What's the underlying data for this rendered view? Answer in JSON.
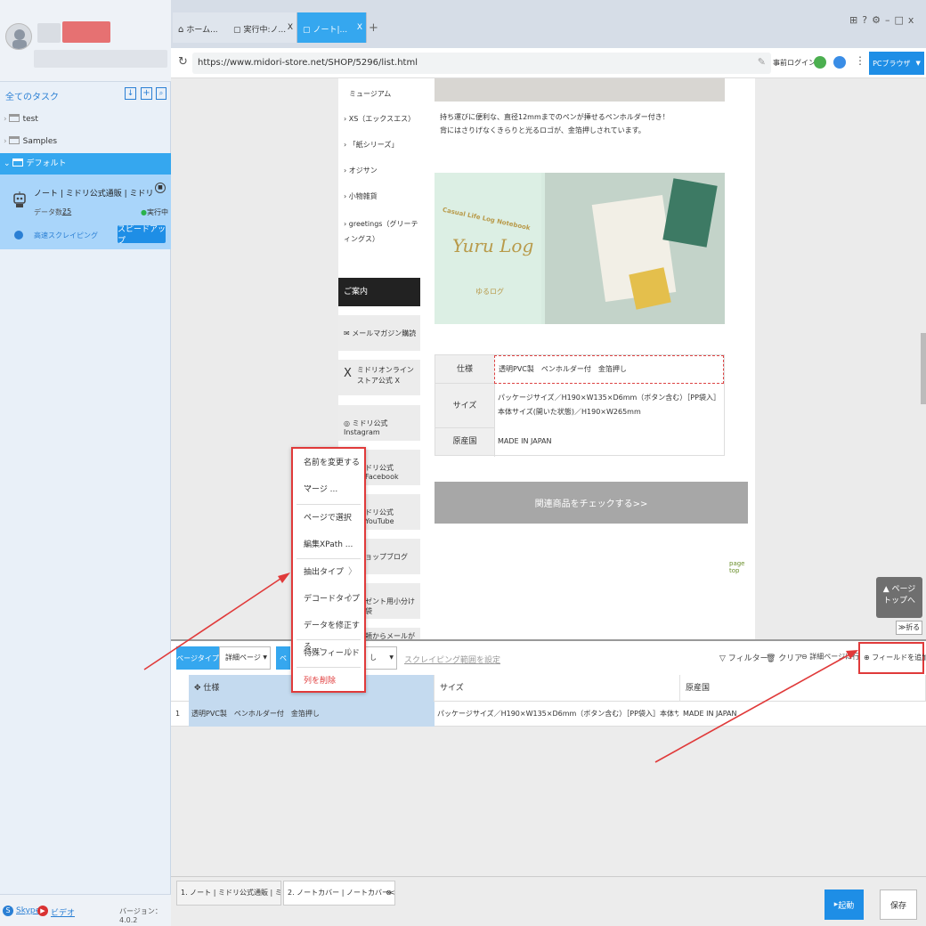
{
  "left": {
    "all_tasks": "全てのタスク",
    "tree": [
      "test",
      "Samples",
      "デフォルト"
    ],
    "task": {
      "name": "ノート | ミドリ公式通販 | ミドリ オンライ...",
      "data_label": "データ数：",
      "data_count": "25",
      "status": "実行中",
      "mode": "高速スクレイピング",
      "speedup": "スピードアップ"
    },
    "footer": {
      "skype": "Skype",
      "video": "ビデオ",
      "version": "バージョン：4.0.2"
    }
  },
  "tabs": [
    "ホーム...",
    "実行中:ノ...",
    "ノート|..."
  ],
  "tab_close": "X",
  "tab_add": "+",
  "url": "https://www.midori-store.net/SHOP/5296/list.html",
  "toolbar": {
    "login": "事前ログイン",
    "browser": "PCブラウザ"
  },
  "webpage": {
    "sidebar_links": [
      "ミュージアム",
      "XS（エックスエス）",
      "「紙シリーズ」",
      "オジサン",
      "小物雑貨",
      "greetings（グリーティングス）"
    ],
    "guide_title": "ご案内",
    "guide_items": [
      "メールマガジン購読",
      "ミドリオンラインストア公式 X",
      "ミドリ公式 Instagram",
      "ドリ公式 Facebook",
      "ドリ公式 YouTube",
      "ョップブログ",
      "ゼント用小分け袋",
      "頼からメールが"
    ],
    "desc_lines": [
      "持ち運びに便利な、直径12mmまでのペンが挿せるペンホルダー付き！",
      "背にはさりげなくきらりと光るロゴが、金箔押しされています。"
    ],
    "product_image_text": [
      "Casual Life Log Notebook",
      "Yuru Log",
      "ゆるログ"
    ],
    "spec_rows": [
      {
        "label": "仕様",
        "value": [
          "透明PVC製　ペンホルダー付　金箔押し"
        ]
      },
      {
        "label": "サイズ",
        "value": [
          "パッケージサイズ／H190×W135×D6mm（ボタン含む）［PP袋入］",
          "本体サイズ(開いた状態)／H190×W265mm"
        ]
      },
      {
        "label": "原産国",
        "value": [
          "MADE IN JAPAN"
        ]
      }
    ],
    "related_button": "関連商品をチェックする>>",
    "page_top_link": "page top",
    "page_top_float": [
      "ページ",
      "トップへ"
    ],
    "collapse": "折る"
  },
  "bottom": {
    "page_type_label": "ページタイプ",
    "page_type_value": "詳細ページ",
    "second_label": "ペ",
    "second_value": "し",
    "scrape_range": "スクレイピング範囲を設定",
    "filter": "フィルター",
    "clear": "クリア",
    "detail": "詳細ページに行",
    "add_field": "フィールドを追加",
    "columns": [
      "仕様",
      "サイズ",
      "原産国"
    ],
    "rows": [
      {
        "num": "1",
        "cells": [
          "透明PVC製　ペンホルダー付　金箔押し",
          "パッケージサイズ／H190×W135×D6mm（ボタン含む）［PP袋入］本体サイズ(開いた状...",
          "MADE IN JAPAN"
        ]
      }
    ],
    "tasks": [
      "1. ノート | ミドリ公式通販 | ミド...",
      "2. ノートカバー | ノートカバー<..."
    ],
    "start": "起動",
    "save": "保存"
  },
  "context_menu": [
    "名前を変更する ...",
    "マージ ...",
    "ページで選択",
    "編集XPath ...",
    "抽出タイプ",
    "デコードタイプ",
    "データを修正する ...",
    "特殊フィールド",
    "列を削除"
  ],
  "colors": {
    "accent": "#35a7ef",
    "highlight": "#e03a3a",
    "task_card": "#a9d5fa"
  }
}
